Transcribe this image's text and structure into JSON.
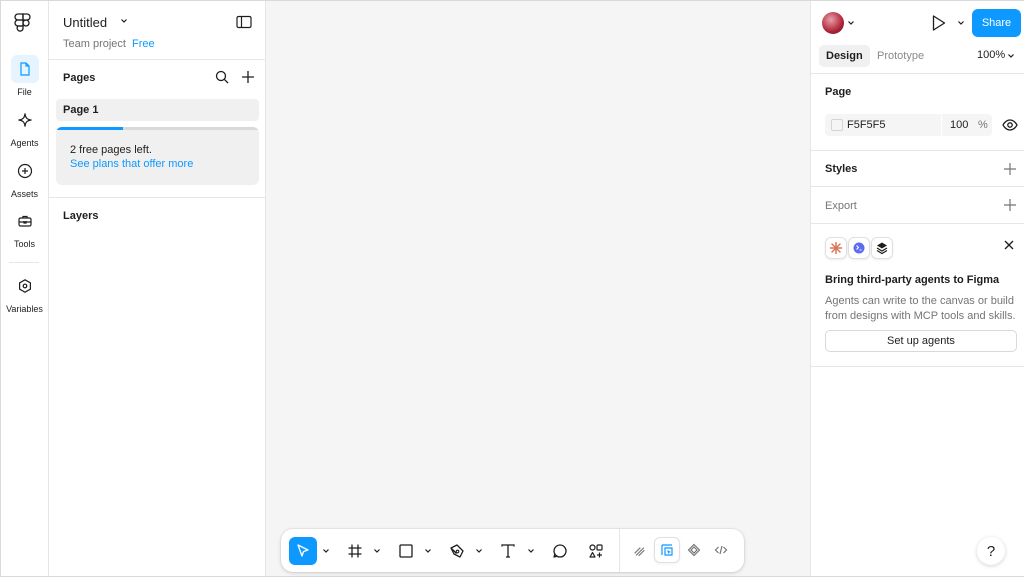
{
  "rail": {
    "items": [
      {
        "label": "File",
        "icon": "file-icon"
      },
      {
        "label": "Agents",
        "icon": "sparkle-icon"
      },
      {
        "label": "Assets",
        "icon": "plus-circle-icon"
      },
      {
        "label": "Tools",
        "icon": "toolbox-icon"
      },
      {
        "label": "Variables",
        "icon": "hexagon-icon"
      }
    ]
  },
  "left_panel": {
    "file_title": "Untitled",
    "team": "Team project",
    "plan": "Free",
    "pages_title": "Pages",
    "pages": [
      "Page 1"
    ],
    "upsell_text": "2 free pages left.",
    "upsell_link": "See plans that offer more",
    "upsell_progress": 0.33,
    "layers_title": "Layers"
  },
  "toolbar": {
    "tools": [
      "move-icon",
      "frame-icon",
      "rectangle-icon",
      "pen-icon",
      "text-icon",
      "comment-icon",
      "actions-icon"
    ],
    "right_tools": [
      "draw-icon",
      "design-mode-icon",
      "component-icon",
      "code-icon"
    ],
    "active_tool": "move",
    "active_right_tool": "design-mode"
  },
  "right_panel": {
    "share_label": "Share",
    "tabs": [
      "Design",
      "Prototype"
    ],
    "zoom": "100%",
    "page_title": "Page",
    "bg_hex": "F5F5F5",
    "bg_opacity": "100",
    "bg_unit": "%",
    "styles_title": "Styles",
    "export_title": "Export",
    "promo_title": "Bring third-party agents to Figma",
    "promo_body": "Agents can write to the canvas or build from designs with MCP tools and skills.",
    "setup_button": "Set up agents"
  },
  "help_label": "?",
  "colors": {
    "accent": "#0d99ff",
    "canvas": "#f5f5f5"
  }
}
